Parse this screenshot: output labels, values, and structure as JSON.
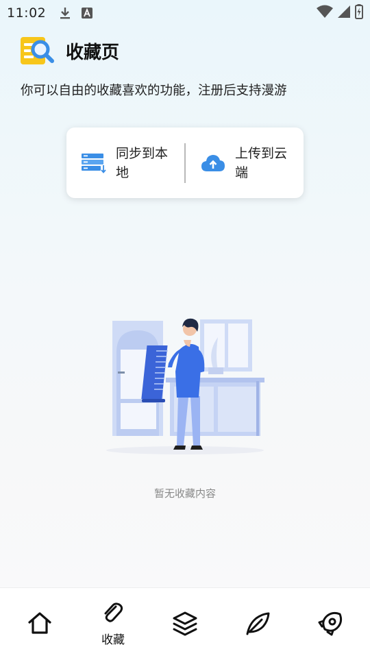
{
  "status_bar": {
    "time": "11:02",
    "left_icons": [
      "download-icon",
      "keyboard-a-icon"
    ],
    "right_icons": [
      "wifi-icon",
      "signal-icon",
      "battery-charging-icon"
    ]
  },
  "header": {
    "icon": "search-list-icon",
    "title": "收藏页"
  },
  "subtitle": "你可以自由的收藏喜欢的功能，注册后支持漫游",
  "sync": {
    "local": {
      "icon": "server-download-icon",
      "label": "同步到本地"
    },
    "cloud": {
      "icon": "cloud-upload-icon",
      "label": "上传到云端"
    }
  },
  "empty": {
    "illustration": "person-with-scroll-illustration",
    "text": "暂无收藏内容"
  },
  "nav": {
    "items": [
      {
        "icon": "home-icon",
        "label": ""
      },
      {
        "icon": "paperclip-icon",
        "label": "收藏",
        "active": true
      },
      {
        "icon": "layers-icon",
        "label": ""
      },
      {
        "icon": "leaf-icon",
        "label": ""
      },
      {
        "icon": "rocket-icon",
        "label": ""
      }
    ]
  },
  "colors": {
    "accent_blue": "#3a8ee6",
    "yellow": "#f5c518",
    "text_gray": "#888888"
  }
}
